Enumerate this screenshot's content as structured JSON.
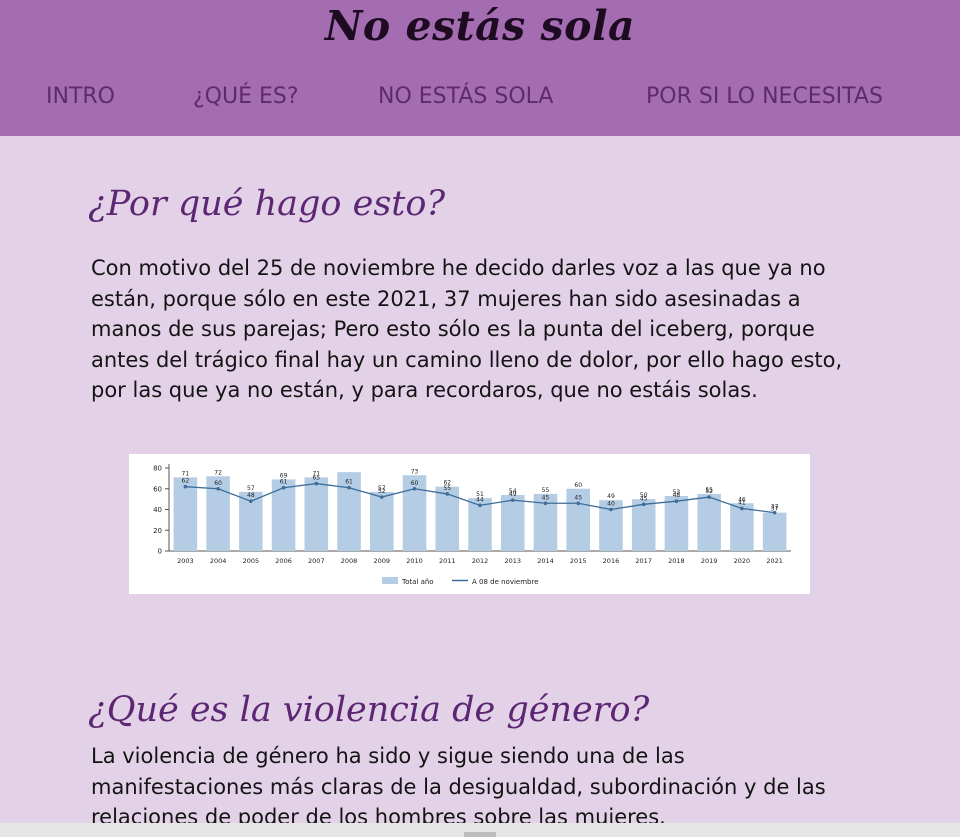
{
  "site": {
    "title": "No estás sola"
  },
  "nav": {
    "items": [
      {
        "label": "INTRO"
      },
      {
        "label": "¿QUÉ ES?"
      },
      {
        "label": "NO ESTÁS SOLA"
      },
      {
        "label": "POR SI LO NECESITAS"
      }
    ]
  },
  "section1": {
    "heading": "¿Por qué hago esto?",
    "paragraph": "Con motivo del 25 de noviembre he decido darles voz a las que ya no están, porque sólo en este 2021, 37 mujeres han sido asesinadas a manos de sus parejas; Pero esto sólo es la punta del iceberg, porque antes del trágico final hay un camino lleno de dolor, por ello hago esto, por las que ya no están, y para recordaros, que no estáis solas."
  },
  "section2": {
    "heading": "¿Qué es la violencia de género?",
    "paragraph": "La violencia de género ha sido y sigue siendo una de las manifestaciones más claras de la desigualdad, subordinación y de las relaciones de poder de los hombres sobre las mujeres."
  },
  "chart_data": {
    "type": "bar",
    "categories": [
      "2003",
      "2004",
      "2005",
      "2006",
      "2007",
      "2008",
      "2009",
      "2010",
      "2011",
      "2012",
      "2013",
      "2014",
      "2015",
      "2016",
      "2017",
      "2018",
      "2019",
      "2020",
      "2021"
    ],
    "series": [
      {
        "name": "Total año",
        "type": "bar",
        "color": "#b4cde4",
        "values": [
          71,
          72,
          57,
          69,
          71,
          76,
          57,
          73,
          62,
          51,
          54,
          55,
          60,
          49,
          50,
          53,
          55,
          46,
          37
        ]
      },
      {
        "name": "A 08 de noviembre",
        "type": "line",
        "color": "#3d6c99",
        "values": [
          62,
          60,
          48,
          61,
          65,
          61,
          52,
          60,
          55,
          44,
          49,
          46,
          46,
          40,
          45,
          48,
          52,
          41,
          37
        ]
      }
    ],
    "bar_labels": [
      "71",
      "72",
      "57",
      "69",
      "71",
      "",
      "57",
      "73",
      "62",
      "51",
      "54",
      "55",
      "60",
      "49",
      "50",
      "53",
      "55",
      "46",
      "37"
    ],
    "line_labels": [
      "62",
      "60",
      "48",
      "61",
      "65",
      "61",
      "52",
      "60",
      "55",
      "44",
      "49",
      "45",
      "45",
      "40",
      "45",
      "48",
      "52",
      "41",
      "37"
    ],
    "yticks": [
      0,
      20,
      40,
      60,
      80
    ],
    "ylim": [
      0,
      80
    ],
    "grid": false,
    "legend": "bottom"
  }
}
